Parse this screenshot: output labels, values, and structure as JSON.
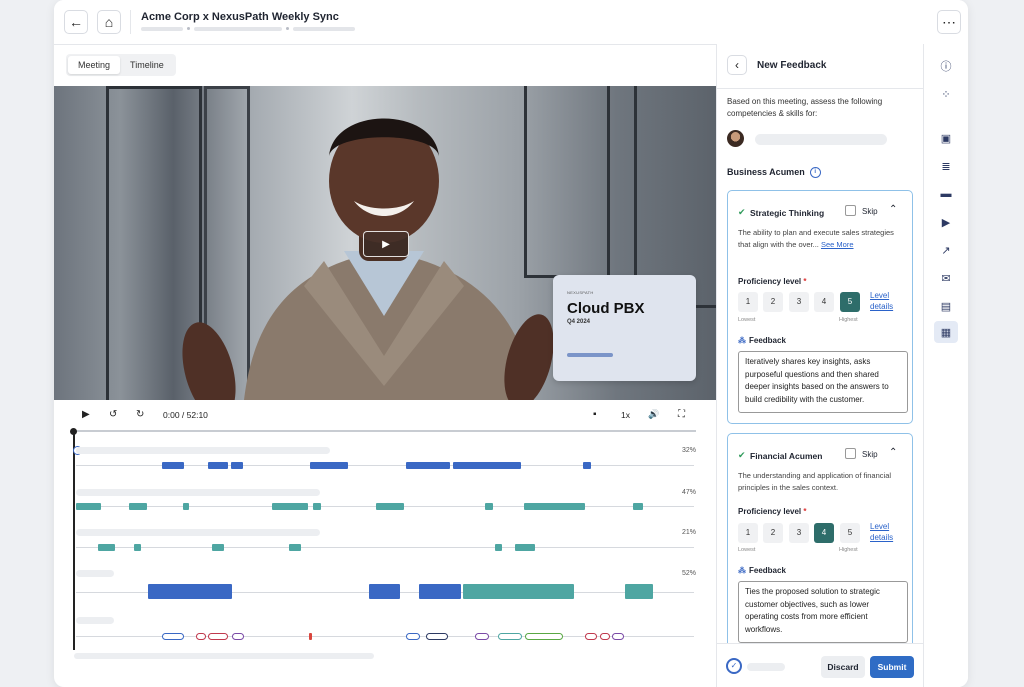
{
  "header": {
    "title": "Acme Corp x NexusPath Weekly Sync",
    "back_icon": "←",
    "home_icon": "⌂",
    "more_icon": "⋯"
  },
  "tabs": [
    {
      "label": "Meeting",
      "active": true
    },
    {
      "label": "Timeline",
      "active": false
    }
  ],
  "slide": {
    "brand": "NEXUSPATH",
    "title": "Cloud PBX",
    "subtitle": "Q4 2024"
  },
  "player": {
    "play_icon": "▶",
    "rewind_icon": "↺",
    "forward_icon": "↻",
    "time": "0:00 / 52:10",
    "speed": "1x",
    "caption_icon": "▪",
    "volume_icon": "🔊",
    "fullscreen_icon": "⛶"
  },
  "tracks": [
    {
      "percent": "32%"
    },
    {
      "percent": "47%"
    },
    {
      "percent": "21%"
    },
    {
      "percent": "52%"
    }
  ],
  "panel": {
    "title": "New Feedback",
    "intro": "Based on this meeting, assess the following competencies & skills for:",
    "section_title": "Business Acumen",
    "info_icon": "i",
    "skip_label": "Skip",
    "proficiency_label": "Proficiency level",
    "required_marker": "*",
    "lowest_label": "Lowest",
    "highest_label": "Highest",
    "level_details": "Level details",
    "feedback_label": "Feedback",
    "levels": [
      "1",
      "2",
      "3",
      "4",
      "5"
    ],
    "cards": [
      {
        "title": "Strategic Thinking",
        "description": "The ability to plan and execute sales strategies that align with the over...",
        "see_more": "See More",
        "selected_level": 5,
        "feedback": "Iteratively shares key insights, asks purposeful questions and then shared deeper insights based on the answers to build credibility with the customer."
      },
      {
        "title": "Financial Acumen",
        "description": "The understanding and application of financial principles in the sales context.",
        "selected_level": 4,
        "feedback": "Ties the proposed solution to strategic customer objectives, such as lower operating costs from more efficient workflows."
      }
    ],
    "discard_label": "Discard",
    "submit_label": "Submit"
  },
  "colors": {
    "accent_blue": "#3a68c4",
    "teal": "#4ea6a2",
    "selected_level": "#2e6d6a",
    "submit": "#2f6cc5"
  },
  "rail_icons": [
    "info-icon",
    "ai-sparkle-icon",
    "contact-card-icon",
    "notes-icon",
    "chat-icon",
    "video-icon",
    "trend-icon",
    "mail-icon",
    "book-icon",
    "feedback-form-icon"
  ]
}
